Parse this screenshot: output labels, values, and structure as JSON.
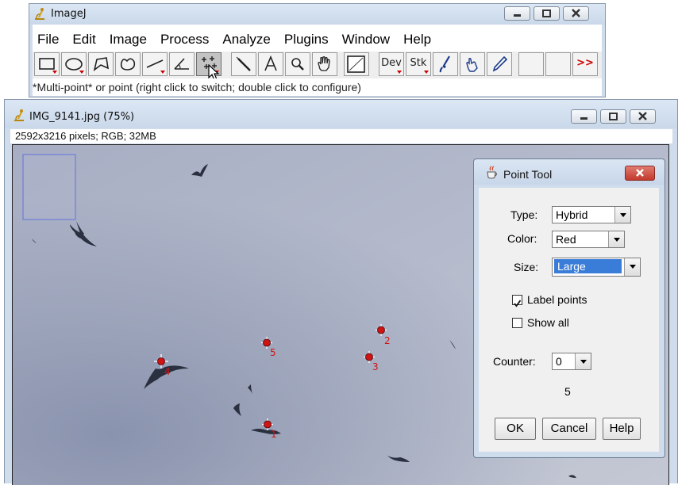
{
  "main_window": {
    "title": "ImageJ",
    "menus": [
      "File",
      "Edit",
      "Image",
      "Process",
      "Analyze",
      "Plugins",
      "Window",
      "Help"
    ],
    "toolbar": {
      "dev_label": "Dev",
      "stk_label": "Stk",
      "more_label": ">>"
    },
    "status": "*Multi-point* or point (right click to switch; double click to configure)"
  },
  "image_window": {
    "title": "IMG_9141.jpg (75%)",
    "info": "2592x3216 pixels; RGB; 32MB",
    "points": [
      {
        "label": "1"
      },
      {
        "label": "2"
      },
      {
        "label": "3"
      },
      {
        "label": "4"
      },
      {
        "label": "5"
      }
    ]
  },
  "point_tool": {
    "title": "Point Tool",
    "type_label": "Type:",
    "type_value": "Hybrid",
    "color_label": "Color:",
    "color_value": "Red",
    "size_label": "Size:",
    "size_value": "Large",
    "label_points": "Label points",
    "label_points_checked": true,
    "show_all": "Show all",
    "show_all_checked": false,
    "counter_label": "Counter:",
    "counter_value": "0",
    "count": "5",
    "ok": "OK",
    "cancel": "Cancel",
    "help": "Help"
  },
  "colors": {
    "sky_light": "#b9bfd0",
    "sky_dark": "#8e98b3",
    "point_color": "#d01414",
    "close_button": "#c9463d"
  }
}
